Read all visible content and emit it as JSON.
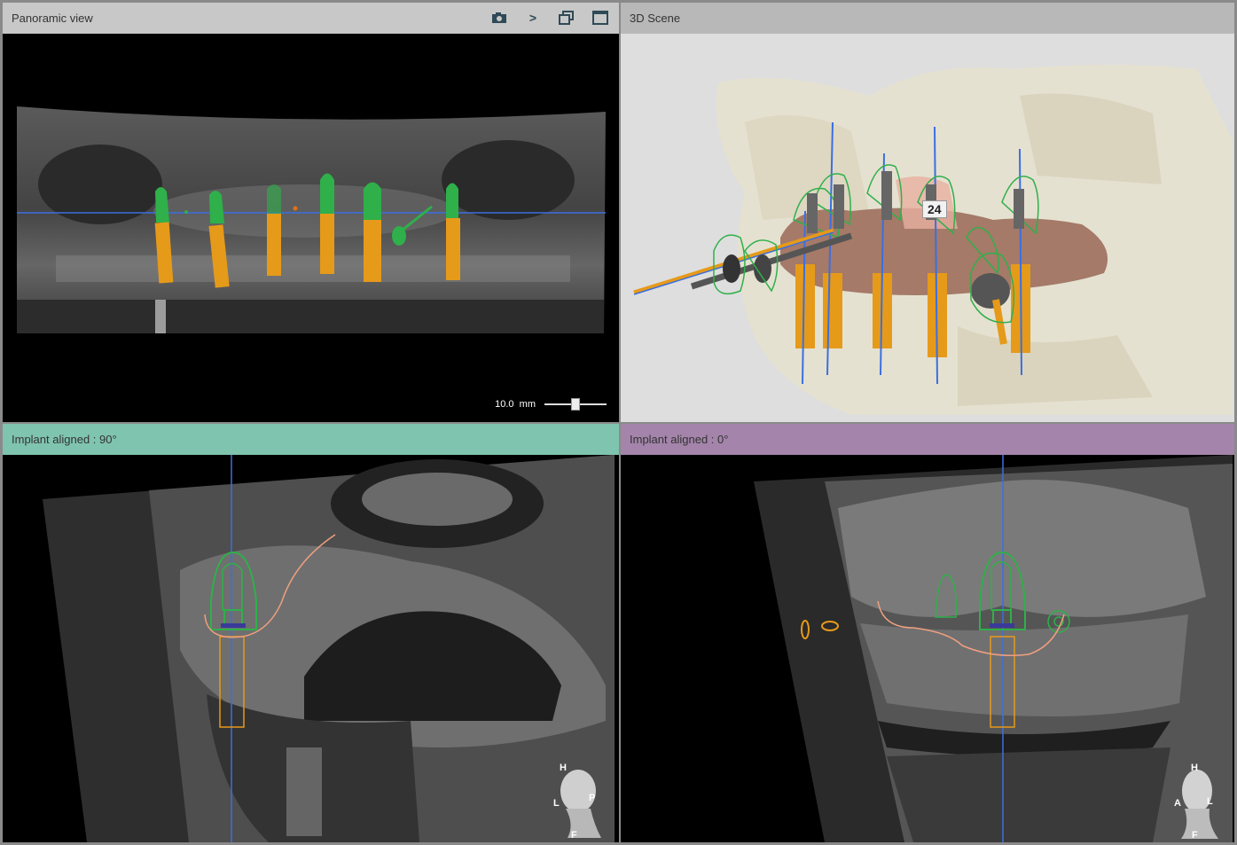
{
  "panes": {
    "panoramic": {
      "title": "Panoramic view",
      "scale_label": "10.0  mm",
      "slider_value": 0.5,
      "tools": [
        {
          "name": "camera-icon"
        },
        {
          "name": "chevron-right-icon",
          "glyph": ">"
        },
        {
          "name": "restore-window-icon"
        },
        {
          "name": "maximize-window-icon"
        }
      ]
    },
    "scene3d": {
      "title": "3D Scene",
      "tooth_label": "24"
    },
    "sagittal": {
      "title": "Implant aligned : 90°",
      "orientation": {
        "top": "H",
        "left": "L",
        "right": "P",
        "bottom": "F"
      }
    },
    "coronal": {
      "title": "Implant aligned : 0°",
      "orientation": {
        "top": "H",
        "left": "A",
        "right": "L",
        "bottom": "F"
      }
    }
  },
  "colors": {
    "implant_body": "#e69a1a",
    "implant_crown": "#2fb04a",
    "axis_line": "#3a6fe0",
    "nerve_curve": "#f0a080",
    "sagittal_header": "#7fc4ae",
    "coronal_header": "#a484ab"
  }
}
